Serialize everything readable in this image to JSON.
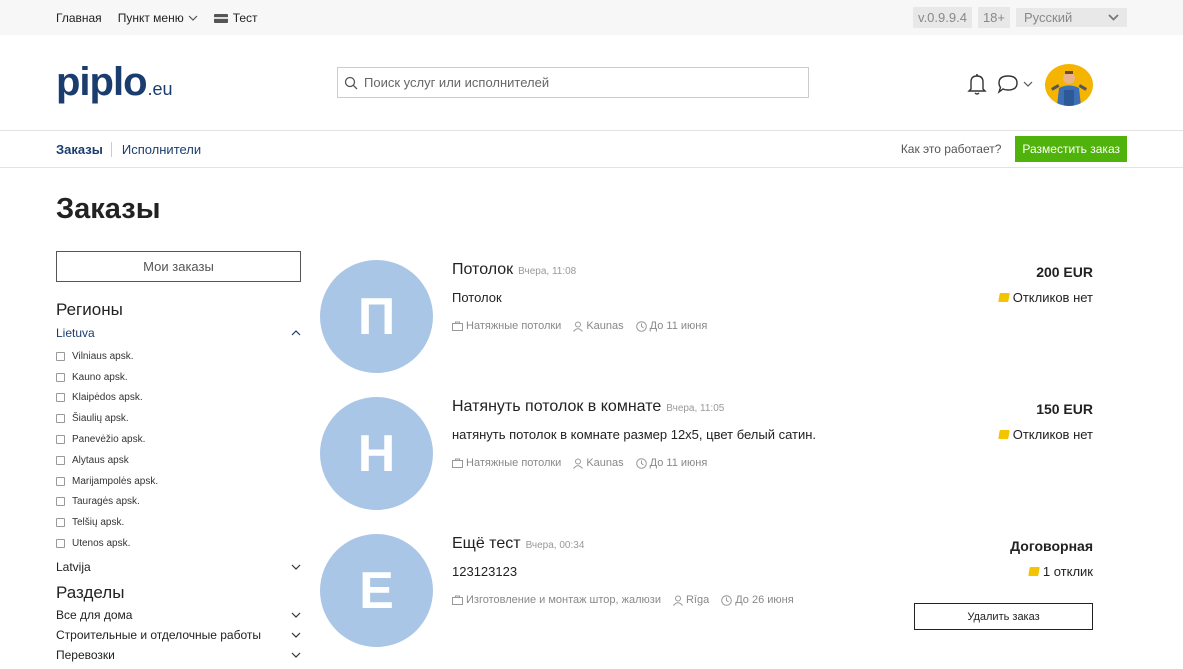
{
  "topbar": {
    "home": "Главная",
    "menu": "Пункт меню",
    "test": "Тест",
    "version": "v.0.9.9.4",
    "age": "18+",
    "language": "Русский"
  },
  "header": {
    "logo_main": "piplo",
    "logo_tld": ".eu",
    "search_placeholder": "Поиск услуг или исполнителей"
  },
  "subnav": {
    "orders_tab": "Заказы",
    "performers_tab": "Исполнители",
    "how_it_works": "Как это работает?",
    "post_order": "Разместить заказ"
  },
  "page_title": "Заказы",
  "sidebar": {
    "my_orders": "Мои заказы",
    "regions_title": "Регионы",
    "region_active": "Lietuva",
    "districts": [
      "Vilniaus apsk.",
      "Kauno apsk.",
      "Klaipėdos apsk.",
      "Šiaulių apsk.",
      "Panevėžio apsk.",
      "Alytaus apsk",
      "Marijampolės apsk.",
      "Tauragės apsk.",
      "Telšių apsk.",
      "Utenos apsk."
    ],
    "region_other": "Latvija",
    "sections_title": "Разделы",
    "sections": [
      "Все для дома",
      "Строительные и отделочные работы",
      "Перевозки"
    ]
  },
  "orders": [
    {
      "letter": "П",
      "title": "Потолок",
      "time": "Вчера, 11:08",
      "desc": "Потолок",
      "category": "Натяжные потолки",
      "city": "Kaunas",
      "deadline": "До 11 июня",
      "price": "200 EUR",
      "responses": "Откликов нет"
    },
    {
      "letter": "Н",
      "title": "Натянуть потолок в комнате",
      "time": "Вчера, 11:05",
      "desc": "натянуть потолок в комнате размер 12х5, цвет белый сатин.",
      "category": "Натяжные потолки",
      "city": "Kaunas",
      "deadline": "До 11 июня",
      "price": "150 EUR",
      "responses": "Откликов нет"
    },
    {
      "letter": "Е",
      "title": "Ещё тест",
      "time": "Вчера, 00:34",
      "desc": "123123123",
      "category": "Изготовление и монтаж штор, жалюзи",
      "city": "Rīga",
      "deadline": "До 26 июня",
      "price": "Договорная",
      "responses": "1 отклик",
      "delete_label": "Удалить заказ"
    }
  ],
  "colors": {
    "brand": "#1b3d6e",
    "accent_green": "#4fb30c",
    "avatar_circle": "#aac6e6",
    "tag_yellow": "#f4c400"
  }
}
